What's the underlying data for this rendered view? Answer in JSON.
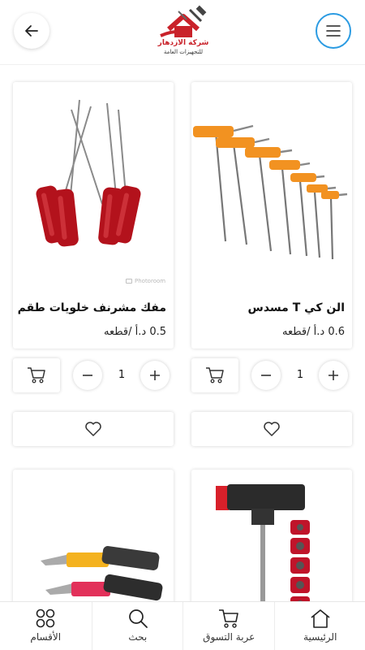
{
  "header": {
    "logo_line1": "شركة الازدهار",
    "logo_line2": "للتجهيزات العامة",
    "back_icon": "arrow-left-icon",
    "menu_icon": "hamburger-menu-icon",
    "menu_accent": "#2b9be2",
    "brand_red": "#c9222a"
  },
  "products": [
    {
      "name": "الن كي T مسدس",
      "price": "0.6 د.أ /قطعه",
      "quantity": "1",
      "image": "t-handle-hex-keys"
    },
    {
      "name": "مفك مشرنف خلويات طقم",
      "price": "0.5 د.أ /قطعه",
      "quantity": "1",
      "image": "screwdriver-set",
      "watermark": "Photoroom"
    },
    {
      "name": "",
      "price": "",
      "image": "t-handle-socket-set"
    },
    {
      "name": "",
      "price": "",
      "image": "utility-cutter-knives"
    }
  ],
  "bottom_nav": [
    {
      "label": "الرئيسية",
      "icon": "home-icon"
    },
    {
      "label": "عربة التسوق",
      "icon": "cart-icon"
    },
    {
      "label": "بحث",
      "icon": "search-icon"
    },
    {
      "label": "الأقسام",
      "icon": "categories-grid-icon"
    }
  ]
}
